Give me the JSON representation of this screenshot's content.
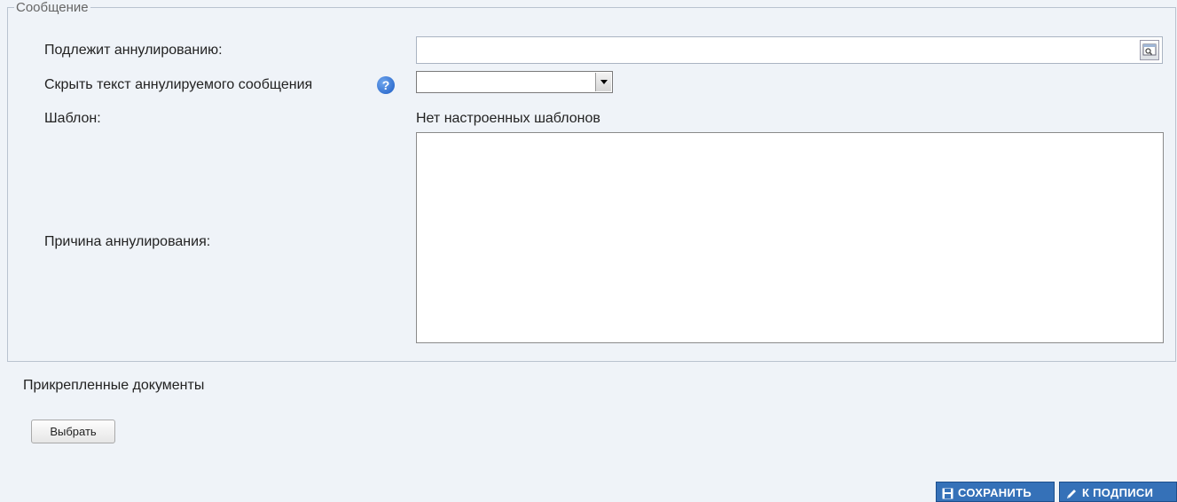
{
  "fieldset": {
    "legend": "Сообщение"
  },
  "form": {
    "cancel_label": "Подлежит аннулированию:",
    "hide_label": "Скрыть текст аннулируемого сообщения",
    "template_label": "Шаблон:",
    "template_value": "Нет настроенных шаблонов",
    "reason_label": "Причина аннулирования:",
    "cancel_input_value": "",
    "hide_select_value": "",
    "reason_value": ""
  },
  "attachments": {
    "title": "Прикрепленные документы",
    "choose_label": "Выбрать"
  },
  "actions": {
    "save_label": "СОХРАНИТЬ",
    "sign_label": "К ПОДПИСИ"
  },
  "icons": {
    "help": "question-icon",
    "lookup": "lookup-icon",
    "save": "floppy-icon",
    "sign": "pen-icon"
  },
  "colors": {
    "background": "#eff3f8",
    "action_button": "#3571b8",
    "help_icon": "#1c5cc4"
  }
}
